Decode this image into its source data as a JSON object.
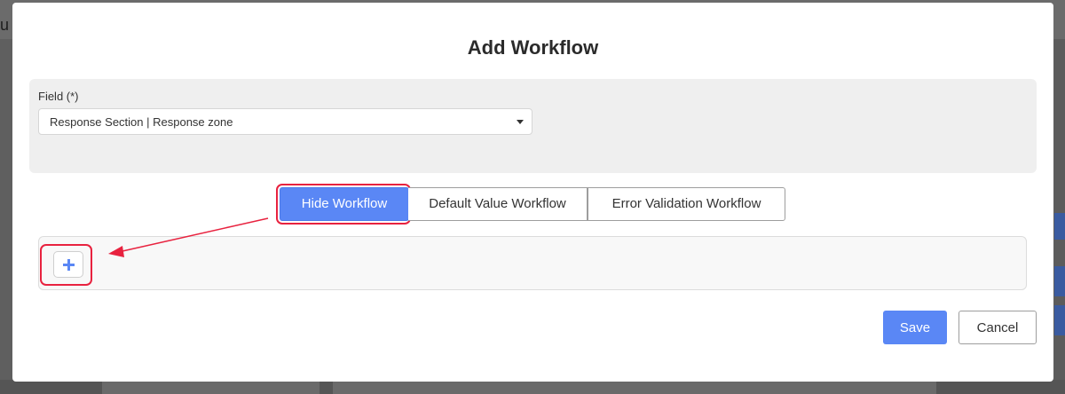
{
  "background": {
    "left_fragment": "u"
  },
  "modal": {
    "title": "Add Workflow"
  },
  "field": {
    "label": "Field (*)",
    "selected_value": "Response Section | Response zone",
    "caret_icon": "caret-down-icon"
  },
  "tabs": [
    {
      "label": "Hide Workflow",
      "active": true
    },
    {
      "label": "Default Value Workflow",
      "active": false
    },
    {
      "label": "Error Validation Workflow",
      "active": false
    }
  ],
  "workflow": {
    "add_icon": "plus-icon"
  },
  "footer": {
    "save_label": "Save",
    "cancel_label": "Cancel"
  },
  "colors": {
    "accent": "#5a87f5",
    "annotation": "#e8223f"
  }
}
